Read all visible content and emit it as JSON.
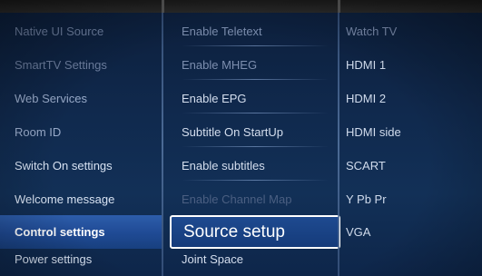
{
  "left_menu": {
    "items": [
      {
        "label": "Native UI Source"
      },
      {
        "label": "SmartTV Settings"
      },
      {
        "label": "Web Services"
      },
      {
        "label": "Room ID"
      },
      {
        "label": "Switch On settings"
      },
      {
        "label": "Welcome message"
      },
      {
        "label": "Control settings"
      },
      {
        "label": "Power settings"
      }
    ]
  },
  "middle_menu": {
    "items": [
      {
        "label": "Enable Teletext"
      },
      {
        "label": "Enable MHEG"
      },
      {
        "label": "Enable EPG"
      },
      {
        "label": "Subtitle On StartUp"
      },
      {
        "label": "Enable subtitles"
      },
      {
        "label": "Enable Channel Map"
      },
      {
        "label": "Source setup"
      },
      {
        "label": "Joint Space"
      }
    ]
  },
  "right_menu": {
    "items": [
      {
        "label": "Watch TV"
      },
      {
        "label": "HDMI 1"
      },
      {
        "label": "HDMI 2"
      },
      {
        "label": "HDMI side"
      },
      {
        "label": "SCART"
      },
      {
        "label": "Y Pb Pr"
      },
      {
        "label": "VGA"
      }
    ]
  },
  "colors": {
    "background": "#10294d",
    "highlight": "#2d5dab",
    "selection_border": "#ffffff"
  }
}
